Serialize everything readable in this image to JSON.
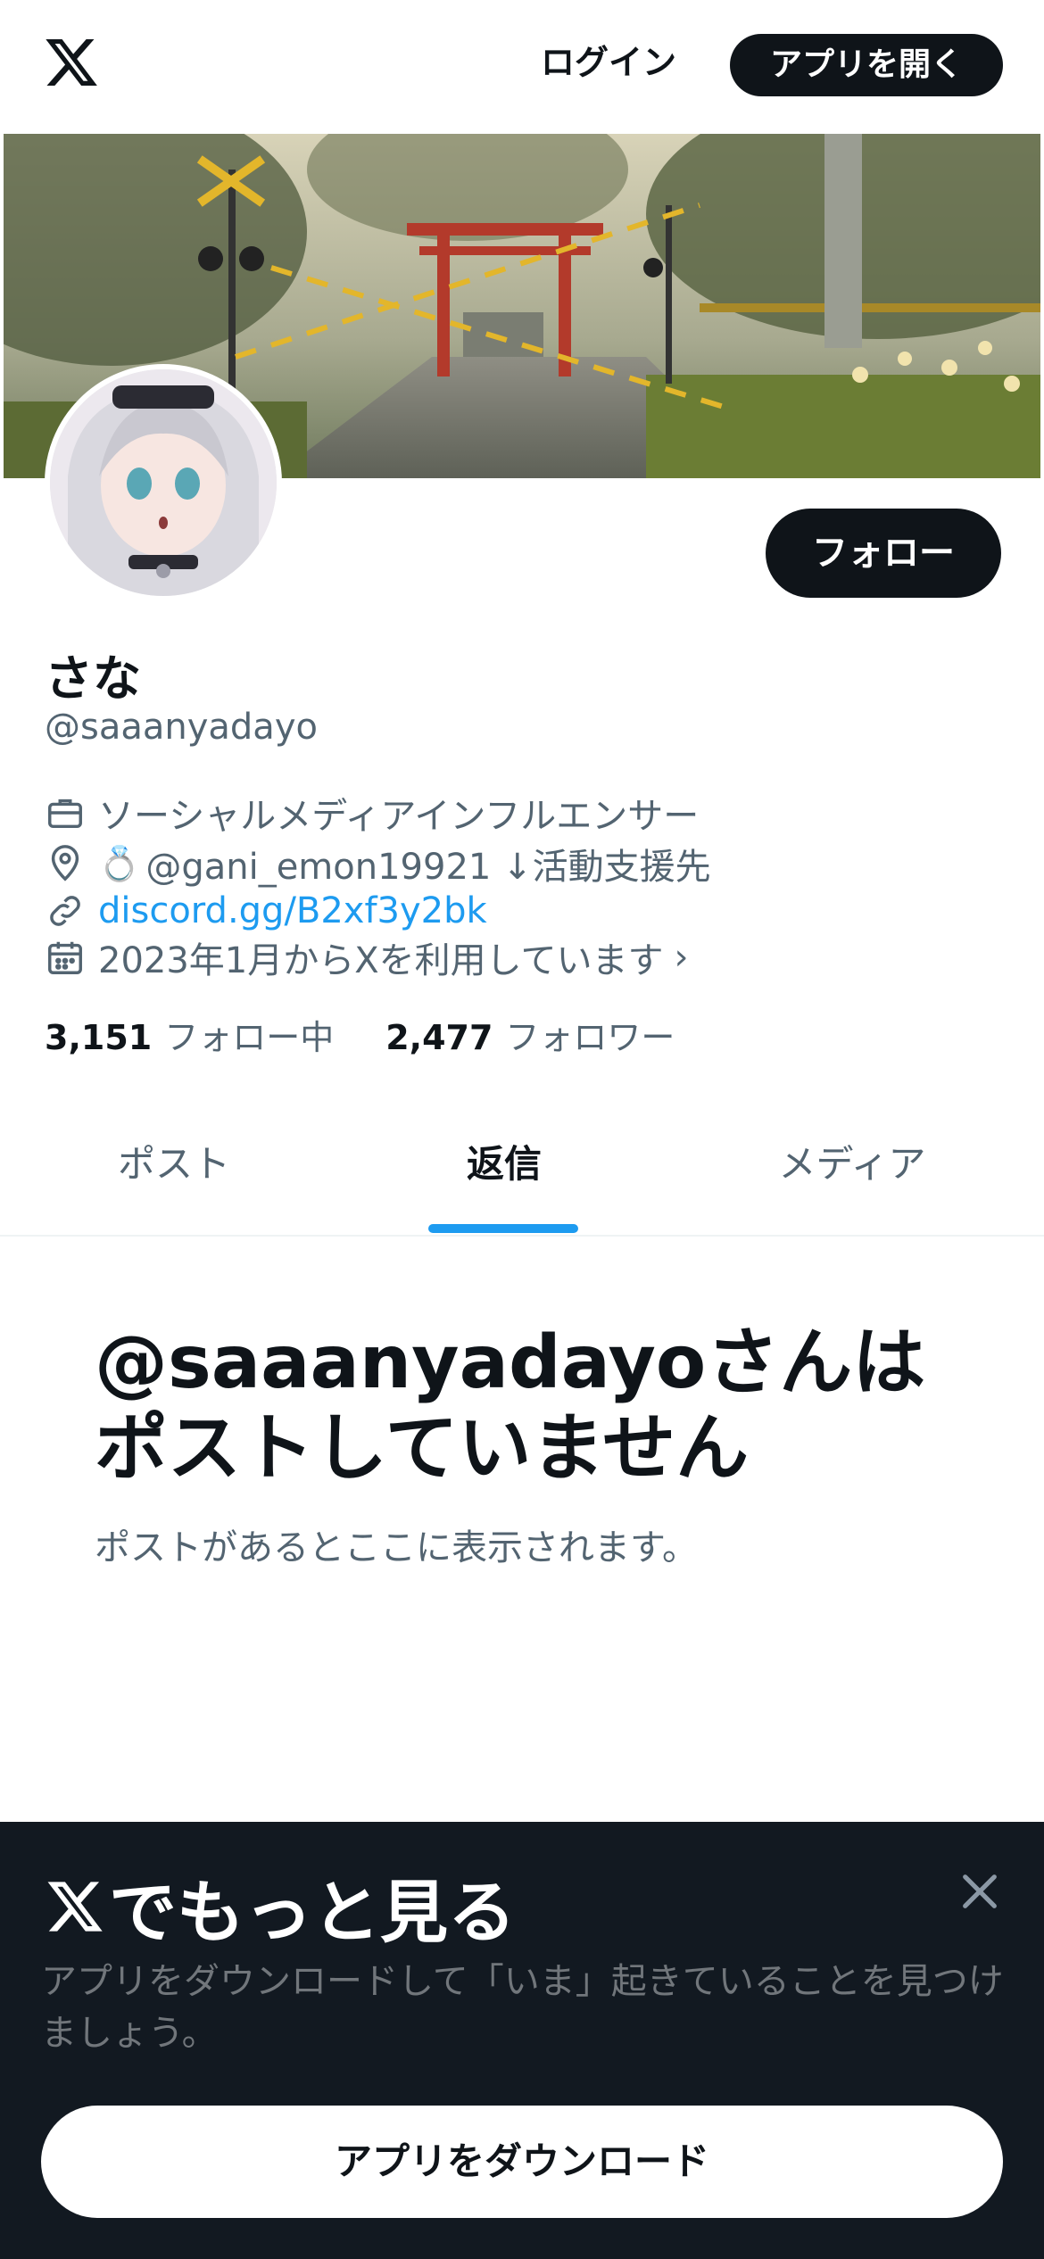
{
  "header": {
    "logo_icon": "x-logo-icon",
    "login_label": "ログイン",
    "open_app_label": "アプリを開く"
  },
  "profile": {
    "display_name": "さな",
    "handle": "@saaanyadayo",
    "follow_label": "フォロー",
    "category": "ソーシャルメディアインフルエンサー",
    "location_emoji": "💍",
    "location_text": "@gani_emon19921 ↓活動支援先",
    "link": "discord.gg/B2xf3y2bk",
    "joined": "2023年1月からXを利用しています",
    "following_count": "3,151",
    "following_label": "フォロー中",
    "followers_count": "2,477",
    "followers_label": "フォロワー"
  },
  "tabs": [
    {
      "label": "ポスト",
      "active": false
    },
    {
      "label": "返信",
      "active": true
    },
    {
      "label": "メディア",
      "active": false
    }
  ],
  "empty_state": {
    "title": "@saaanyadayoさんはポストしていません",
    "subtitle": "ポストがあるとここに表示されます。"
  },
  "bottom_sheet": {
    "title": "でもっと見る",
    "text": "アプリをダウンロードして「いま」起きていることを見つけましょう。",
    "download_label": "アプリをダウンロード"
  },
  "colors": {
    "accent": "#1d9bf0",
    "text_primary": "#0f1419",
    "text_secondary": "#536471",
    "sheet_bg": "#121921"
  }
}
